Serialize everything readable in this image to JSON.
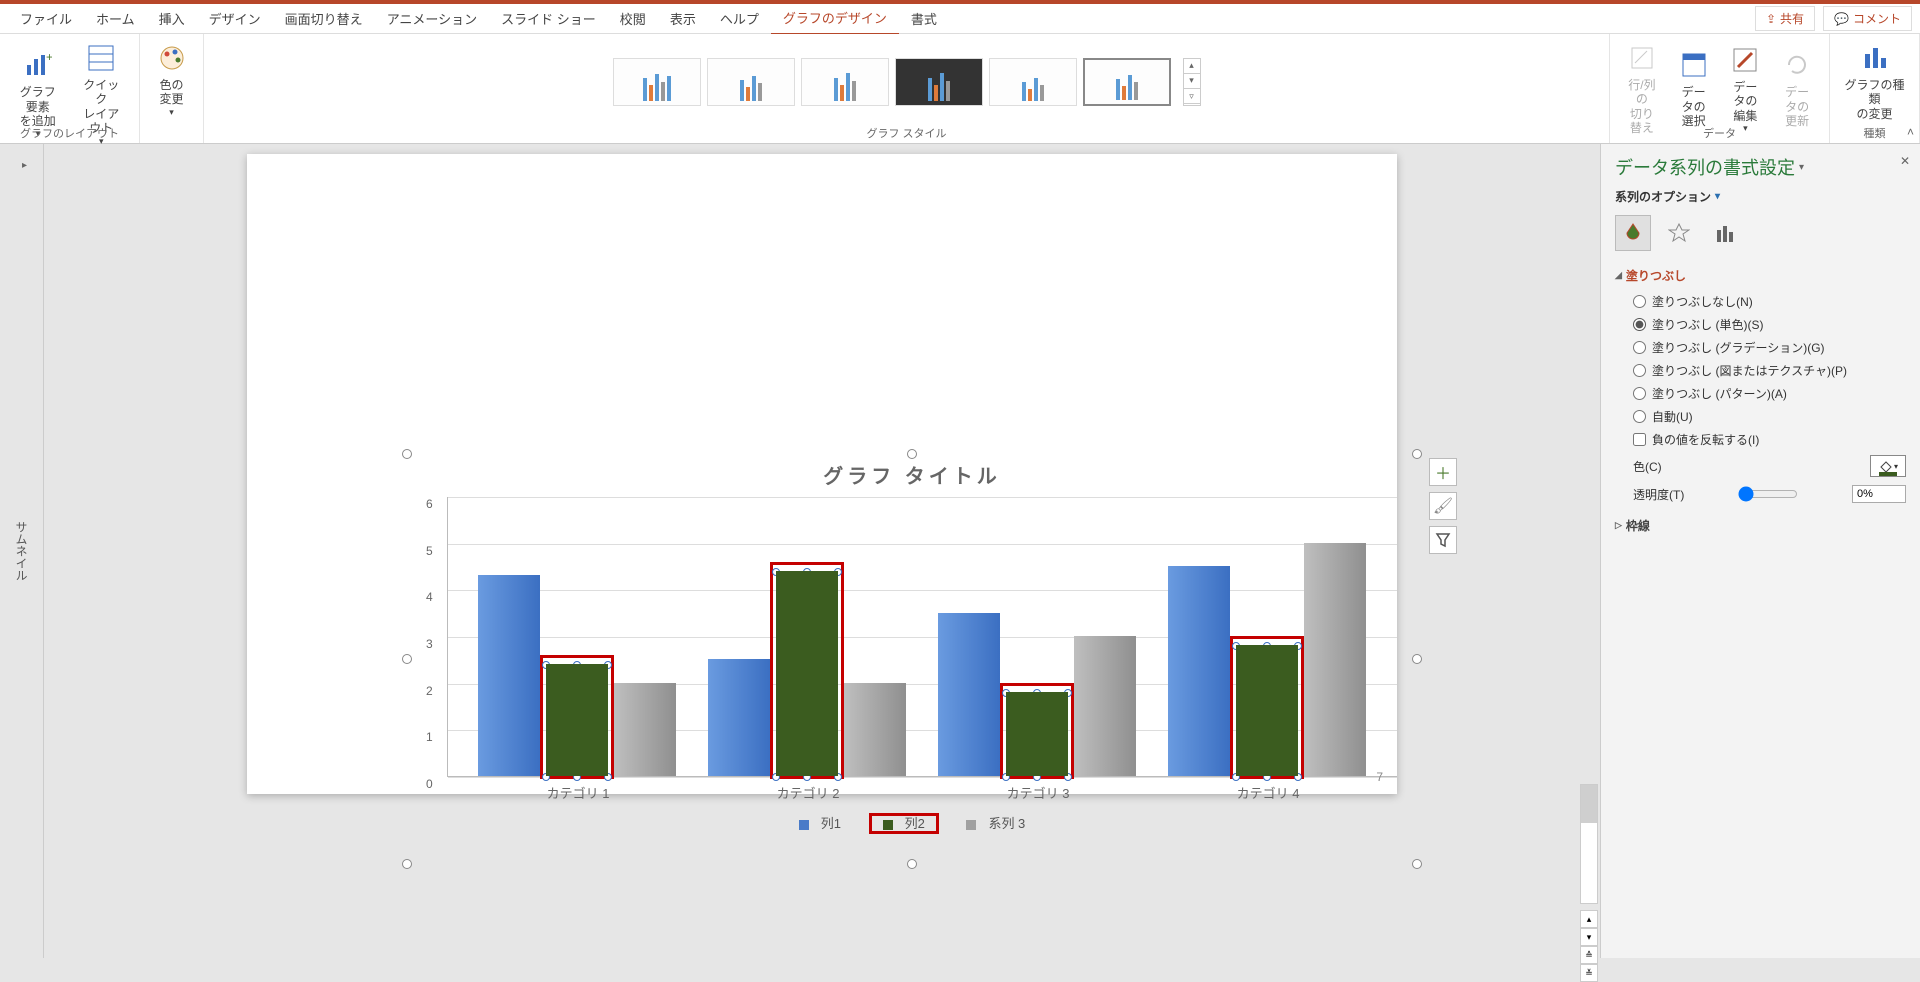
{
  "titlebar": {
    "share": "共有",
    "comment": "コメント"
  },
  "tabs": {
    "file": "ファイル",
    "home": "ホーム",
    "insert": "挿入",
    "design": "デザイン",
    "transition": "画面切り替え",
    "animation": "アニメーション",
    "slideshow": "スライド ショー",
    "review": "校閲",
    "view": "表示",
    "help": "ヘルプ",
    "chartdesign": "グラフのデザイン",
    "format": "書式"
  },
  "ribbon": {
    "layout_group": "グラフのレイアウト",
    "add_element": "グラフ要素\nを追加",
    "quick_layout": "クイック\nレイアウト",
    "color_change": "色の\n変更",
    "style_group": "グラフ スタイル",
    "data_group": "データ",
    "switch_rc": "行/列の\n切り替え",
    "select_data": "データの\n選択",
    "edit_data": "データの\n編集",
    "refresh_data": "データの\n更新",
    "type_group": "種類",
    "change_type": "グラフの種類\nの変更"
  },
  "thumbs": {
    "label": "サムネイル"
  },
  "slide": {
    "number": "7"
  },
  "chart_data": {
    "type": "bar",
    "title": "グラフ タイトル",
    "categories": [
      "カテゴリ 1",
      "カテゴリ 2",
      "カテゴリ 3",
      "カテゴリ 4"
    ],
    "series": [
      {
        "name": "列1",
        "values": [
          4.3,
          2.5,
          3.5,
          4.5
        ],
        "color": "#4a7bc8"
      },
      {
        "name": "列2",
        "values": [
          2.4,
          4.4,
          1.8,
          2.8
        ],
        "color": "#3b5c1f"
      },
      {
        "name": "系列 3",
        "values": [
          2.0,
          2.0,
          3.0,
          5.0
        ],
        "color": "#a0a0a0"
      }
    ],
    "ylim": [
      0,
      6
    ],
    "yticks": [
      0,
      1,
      2,
      3,
      4,
      5,
      6
    ],
    "selected_series": "列2"
  },
  "pane": {
    "title": "データ系列の書式設定",
    "options_label": "系列のオプション",
    "fill_section": "塗りつぶし",
    "fill_none": "塗りつぶしなし(N)",
    "fill_solid": "塗りつぶし (単色)(S)",
    "fill_gradient": "塗りつぶし (グラデーション)(G)",
    "fill_picture": "塗りつぶし (図またはテクスチャ)(P)",
    "fill_pattern": "塗りつぶし (パターン)(A)",
    "fill_auto": "自動(U)",
    "invert_neg": "負の値を反転する(I)",
    "color_label": "色(C)",
    "transparency_label": "透明度(T)",
    "transparency_value": "0%",
    "line_section": "枠線"
  }
}
